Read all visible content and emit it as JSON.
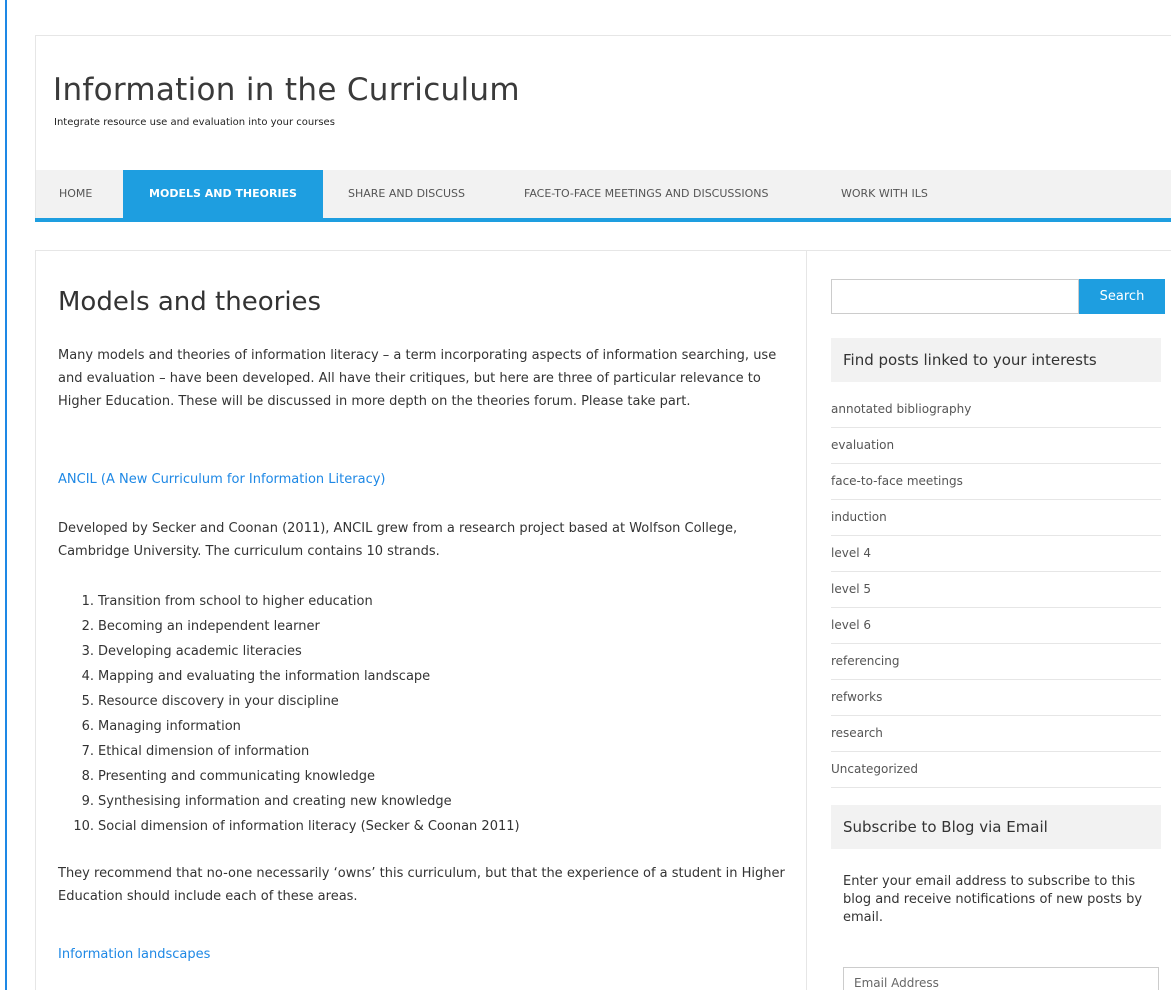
{
  "header": {
    "site_title": "Information in the Curriculum",
    "tagline": "Integrate resource use and evaluation into your courses"
  },
  "nav": {
    "items": [
      {
        "label": "HOME",
        "active": false
      },
      {
        "label": "MODELS AND THEORIES",
        "active": true
      },
      {
        "label": "SHARE AND DISCUSS",
        "active": false
      },
      {
        "label": "FACE-TO-FACE MEETINGS AND DISCUSSIONS",
        "active": false
      },
      {
        "label": "WORK WITH ILS",
        "active": false
      }
    ]
  },
  "main": {
    "title": "Models and theories",
    "intro": "Many models and theories of information literacy – a term incorporating aspects of information searching, use and evaluation – have been developed. All have their critiques, but here are three of particular relevance to Higher Education. These will be discussed in more depth on the theories forum. Please take part.",
    "ancil_link": "ANCIL (A New Curriculum for Information Literacy)",
    "ancil_desc": "Developed by Secker and Coonan (2011), ANCIL grew from a research project based at Wolfson College, Cambridge University. The curriculum contains 10 strands.",
    "strands": [
      "Transition from school to higher education",
      "Becoming an independent learner",
      "Developing academic literacies",
      "Mapping and evaluating the information landscape",
      "Resource discovery in your discipline",
      "Managing information",
      "Ethical dimension of information",
      "Presenting and communicating knowledge",
      "Synthesising information and creating new knowledge",
      "Social dimension of information literacy (Secker & Coonan 2011)"
    ],
    "recommend": "They recommend that no-one necessarily ‘owns’ this curriculum, but that the experience of a student in Higher Education should include each of these areas.",
    "landscapes_link": "Information landscapes"
  },
  "sidebar": {
    "search_button": "Search",
    "search_placeholder": "",
    "tags_title": "Find posts linked to your interests",
    "tags": [
      "annotated bibliography",
      "evaluation",
      "face-to-face meetings",
      "induction",
      "level 4",
      "level 5",
      "level 6",
      "referencing",
      "refworks",
      "research",
      "Uncategorized"
    ],
    "subscribe_title": "Subscribe to Blog via Email",
    "subscribe_text": "Enter your email address to subscribe to this blog and receive notifications of new posts by email.",
    "email_placeholder": "Email Address"
  },
  "colors": {
    "accent": "#1e9ee0",
    "link": "#1e88e5"
  }
}
